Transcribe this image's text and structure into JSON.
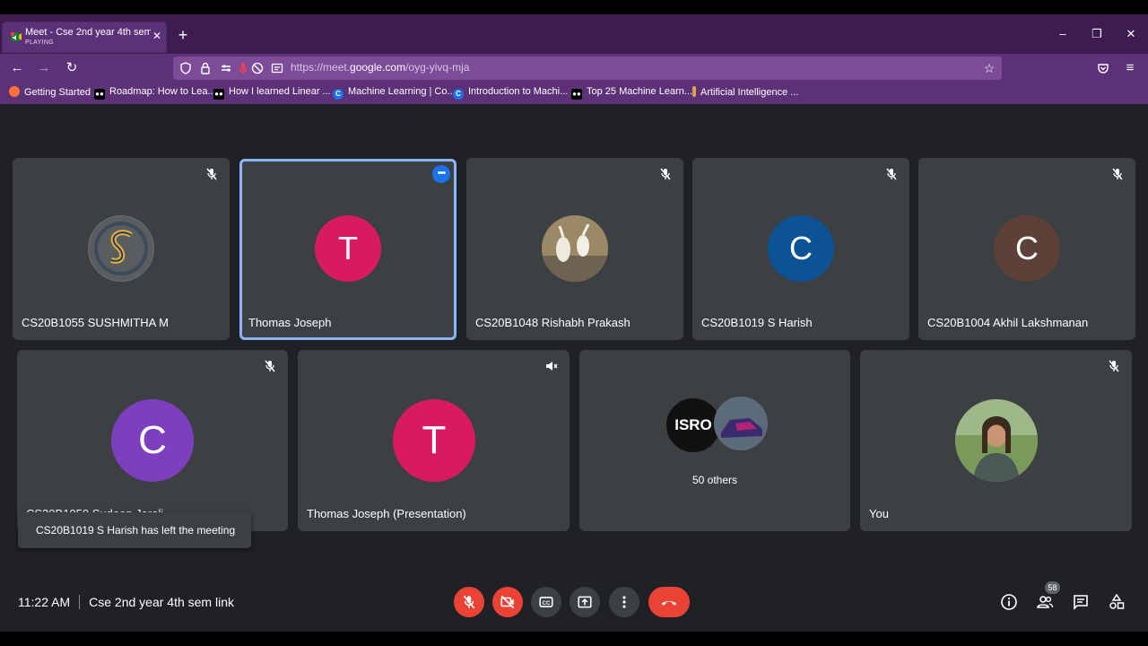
{
  "browser": {
    "tab": {
      "title": "Meet - Cse 2nd year 4th sem link",
      "status": "PLAYING"
    },
    "url": {
      "prefix": "https://meet.",
      "domain": "google.com",
      "path": "/oyg-yivq-mja"
    },
    "bookmarks": [
      {
        "label": "Getting Started"
      },
      {
        "label": "Roadmap: How to Lea..."
      },
      {
        "label": "How I learned Linear ..."
      },
      {
        "label": "Machine Learning | Co..."
      },
      {
        "label": "Introduction to Machi..."
      },
      {
        "label": "Top 25 Machine Learn..."
      },
      {
        "label": "Artificial Intelligence ..."
      }
    ]
  },
  "meet": {
    "tiles": [
      {
        "name": "CS20B1055 SUSHMITHA M",
        "muted": true
      },
      {
        "name": "Thomas Joseph",
        "avatar_letter": "T",
        "avatar_color": "#d81b60",
        "active": true
      },
      {
        "name": "CS20B1048 Rishabh Prakash",
        "muted": true
      },
      {
        "name": "CS20B1019 S Harish",
        "avatar_letter": "C",
        "avatar_color": "#0b5394",
        "muted": true
      },
      {
        "name": "CS20B1004 Akhil Lakshmanan",
        "avatar_letter": "C",
        "avatar_color": "#5d4037",
        "muted": true
      },
      {
        "name": "CS20B1050 Sudeep Jarali",
        "avatar_letter": "C",
        "avatar_color": "#7e3fbf",
        "muted": true
      },
      {
        "name": "Thomas Joseph (Presentation)",
        "avatar_letter": "T",
        "avatar_color": "#d81b60",
        "muted": true
      },
      {
        "name": "50 others",
        "isro_label": "ISRO"
      },
      {
        "name": "You",
        "muted": true
      }
    ],
    "toast": "CS20B1019 S Harish has left the meeting",
    "time": "11:22 AM",
    "meeting_title": "Cse 2nd year 4th sem link",
    "participant_count": "58",
    "colors": {
      "background": "#202124",
      "tile": "#3c4043",
      "active_border": "#8ab4f8",
      "danger": "#ea4335",
      "chrome": "#5c3177"
    }
  }
}
